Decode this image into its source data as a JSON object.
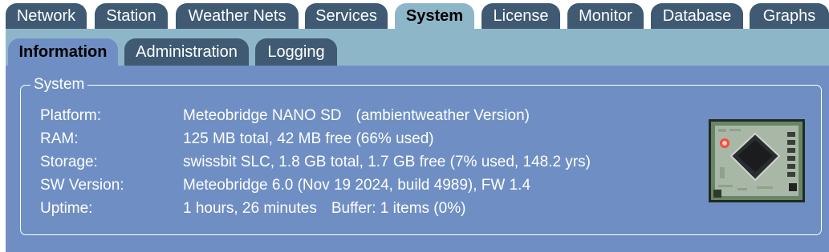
{
  "top_tabs": [
    {
      "label": "Network",
      "active": false
    },
    {
      "label": "Station",
      "active": false
    },
    {
      "label": "Weather Nets",
      "active": false
    },
    {
      "label": "Services",
      "active": false
    },
    {
      "label": "System",
      "active": true
    },
    {
      "label": "License",
      "active": false
    },
    {
      "label": "Monitor",
      "active": false
    },
    {
      "label": "Database",
      "active": false
    },
    {
      "label": "Graphs",
      "active": false
    }
  ],
  "sub_tabs": [
    {
      "label": "Information",
      "active": true
    },
    {
      "label": "Administration",
      "active": false
    },
    {
      "label": "Logging",
      "active": false
    }
  ],
  "system": {
    "legend": "System",
    "platform_label": "Platform:",
    "platform_value": "Meteobridge NANO SD",
    "platform_version": "(ambientweather Version)",
    "ram_label": "RAM:",
    "ram_value": "125 MB total, 42 MB free (66% used)",
    "storage_label": "Storage:",
    "storage_value": "swissbit SLC, 1.8 GB total, 1.7 GB free (7% used, 148.2 yrs)",
    "sw_label": "SW Version:",
    "sw_value": "Meteobridge 6.0 (Nov 19 2024, build 4989), FW 1.4",
    "uptime_label": "Uptime:",
    "uptime_value": "1 hours, 26 minutes",
    "buffer_value": "Buffer: 1 items (0%)"
  },
  "colors": {
    "tab_inactive": "#3f5a72",
    "tab_active": "#8eb6c9",
    "panel": "#6f8fc4"
  }
}
